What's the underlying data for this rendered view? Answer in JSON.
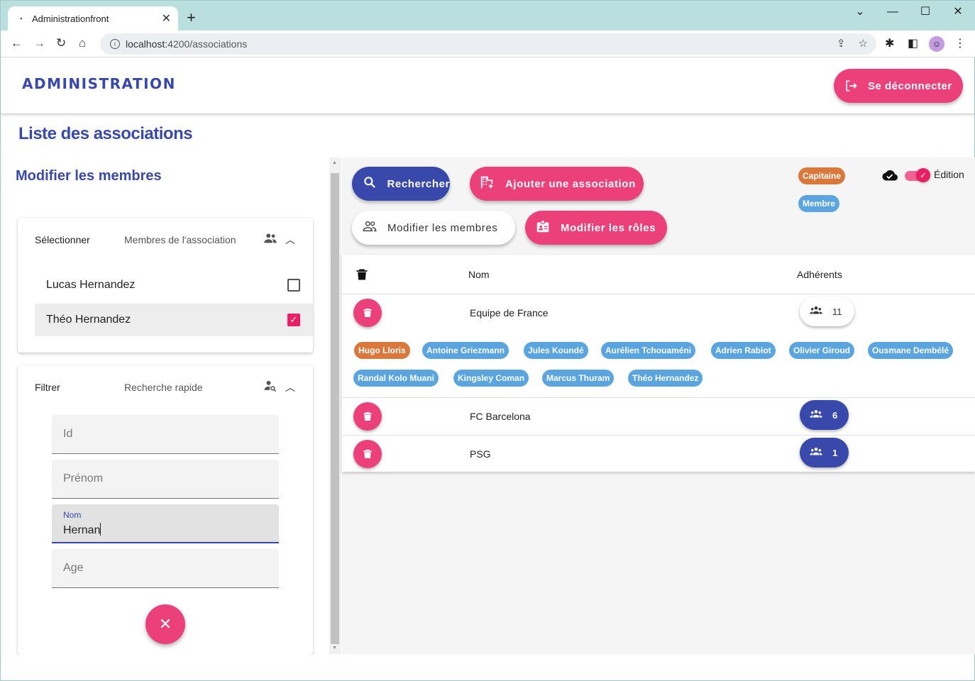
{
  "browser": {
    "tab_title": "Administrationfront",
    "tab_close": "✕",
    "new_tab": "+",
    "url_host": "localhost:",
    "url_rest": "4200/associations",
    "win_min": "—",
    "win_max": "☐",
    "win_close": "✕",
    "tab_dropdown": "⌄"
  },
  "header": {
    "brand": "ADMINISTRATION",
    "logout_label": "Se déconnecter"
  },
  "page": {
    "title": "Liste des associations",
    "section_title": "Modifier les membres"
  },
  "select_panel": {
    "title": "Sélectionner",
    "description": "Membres de l'association",
    "items": [
      {
        "label": "Lucas Hernandez",
        "checked": false
      },
      {
        "label": "Théo Hernandez",
        "checked": true
      }
    ]
  },
  "filter_panel": {
    "title": "Filtrer",
    "description": "Recherche rapide",
    "fields": {
      "id_placeholder": "Id",
      "prenom_placeholder": "Prénom",
      "nom_label": "Nom",
      "nom_value": "Hernan",
      "age_placeholder": "Age"
    },
    "clear_icon": "✕"
  },
  "actions": {
    "search": "Rechercher",
    "add_association": "Ajouter une association",
    "edit_members": "Modifier les membres",
    "edit_roles": "Modifier les rôles"
  },
  "legend": {
    "captain": "Capitaine",
    "member": "Membre",
    "edit_toggle_label": "Édition",
    "edit_toggle_on": true
  },
  "table": {
    "columns": {
      "name": "Nom",
      "members": "Adhérents"
    },
    "rows": [
      {
        "name": "Equipe de France",
        "count": "11",
        "expanded": true,
        "members": [
          {
            "name": "Hugo Lloris",
            "role": "captain"
          },
          {
            "name": "Antoine Griezmann",
            "role": "member"
          },
          {
            "name": "Jules Koundé",
            "role": "member"
          },
          {
            "name": "Aurélien Tchouaméni",
            "role": "member"
          },
          {
            "name": "Adrien Rabiot",
            "role": "member"
          },
          {
            "name": "Olivier Giroud",
            "role": "member"
          },
          {
            "name": "Ousmane Dembélé",
            "role": "member"
          },
          {
            "name": "Randal Kolo Muani",
            "role": "member"
          },
          {
            "name": "Kingsley Coman",
            "role": "member"
          },
          {
            "name": "Marcus Thuram",
            "role": "member"
          },
          {
            "name": "Théo Hernandez",
            "role": "member"
          }
        ]
      },
      {
        "name": "FC Barcelona",
        "count": "6",
        "expanded": false
      },
      {
        "name": "PSG",
        "count": "1",
        "expanded": false
      }
    ]
  },
  "colors": {
    "primary": "#3949ab",
    "accent": "#ec407a",
    "captain": "#d9783a",
    "member": "#5aa5e0"
  }
}
